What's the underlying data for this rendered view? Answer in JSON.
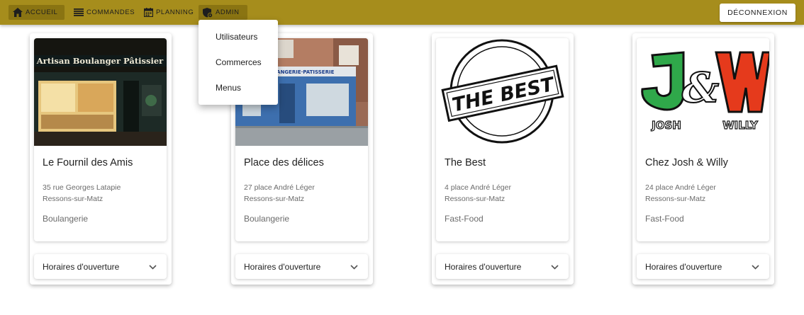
{
  "nav": {
    "accueil": "ACCUEIL",
    "commandes": "COMMANDES",
    "planning": "PLANNING",
    "admin": "ADMIN",
    "logout": "DÉCONNEXION"
  },
  "admin_menu": [
    "Utilisateurs",
    "Commerces",
    "Menus"
  ],
  "colors": {
    "topbar": "#a68d1c",
    "active_button": "#8a7412"
  },
  "shops": [
    {
      "name": "Le Fournil des Amis",
      "address": "35 rue Georges Latapie",
      "city": "Ressons-sur-Matz",
      "type": "Boulangerie",
      "sign": "Artisan Boulanger Pâtissier",
      "hours_label": "Horaires d'ouverture"
    },
    {
      "name": "Place des délices",
      "address": "27 place André Léger",
      "city": "Ressons-sur-Matz",
      "type": "Boulangerie",
      "sign": "BOULANGERIE·PATISSERIE",
      "hours_label": "Horaires d'ouverture"
    },
    {
      "name": "The Best",
      "address": "4 place André Léger",
      "city": "Ressons-sur-Matz",
      "type": "Fast-Food",
      "logo_text": "THE BEST",
      "hours_label": "Horaires d'ouverture"
    },
    {
      "name": "Chez Josh & Willy",
      "address": "24 place André Léger",
      "city": "Ressons-sur-Matz",
      "type": "Fast-Food",
      "logo_text": "J&W",
      "logo_left": "JOSH",
      "logo_right": "WILLY",
      "hours_label": "Horaires d'ouverture"
    }
  ]
}
